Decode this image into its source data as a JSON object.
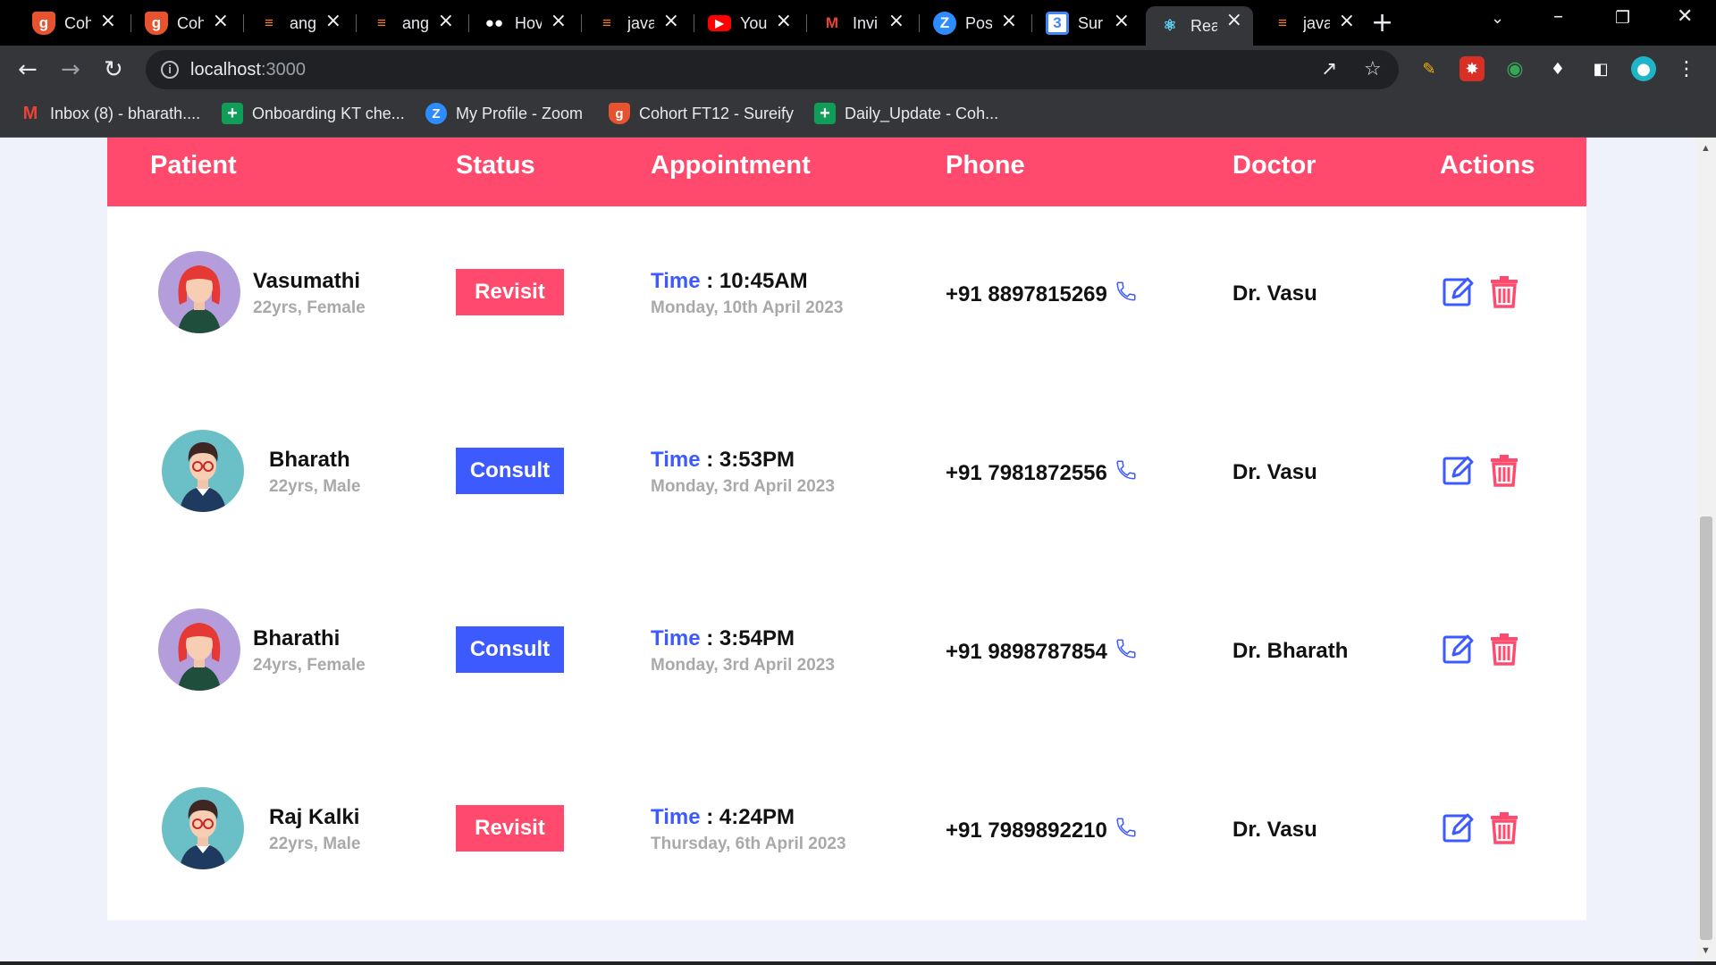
{
  "browser": {
    "tabs": [
      {
        "label": "Coh",
        "icon": "shield-icon",
        "color": "#e8532f"
      },
      {
        "label": "Coh",
        "icon": "shield-icon",
        "color": "#e8532f"
      },
      {
        "label": "ang",
        "icon": "stackoverflow-icon",
        "color": "#f48024"
      },
      {
        "label": "ang",
        "icon": "stackoverflow-icon",
        "color": "#f48024"
      },
      {
        "label": "Hov",
        "icon": "medium-icon",
        "color": "#ffffff"
      },
      {
        "label": "java",
        "icon": "stackoverflow-icon",
        "color": "#f48024"
      },
      {
        "label": "You",
        "icon": "youtube-icon",
        "color": "#ff0000"
      },
      {
        "label": "Invi",
        "icon": "gmail-icon",
        "color": "#ea4335"
      },
      {
        "label": "Pos",
        "icon": "zoom-icon",
        "color": "#2d8cff"
      },
      {
        "label": "Sur",
        "icon": "calendar-icon",
        "color": "#4285f4"
      },
      {
        "label": "Rea",
        "icon": "react-icon",
        "color": "#61dafb",
        "active": true
      },
      {
        "label": "java",
        "icon": "stackoverflow-icon",
        "color": "#f48024"
      }
    ],
    "url_host": "localhost",
    "url_port": ":3000",
    "bookmarks": [
      {
        "label": "Inbox (8) - bharath....",
        "icon": "gmail-icon"
      },
      {
        "label": "Onboarding KT che...",
        "icon": "sheets-icon"
      },
      {
        "label": "My Profile - Zoom",
        "icon": "zoom-icon"
      },
      {
        "label": "Cohort FT12 - Sureify",
        "icon": "shield-icon"
      },
      {
        "label": "Daily_Update - Coh...",
        "icon": "sheets-icon"
      }
    ]
  },
  "table": {
    "headers": {
      "patient": "Patient",
      "status": "Status",
      "appointment": "Appointment",
      "phone": "Phone",
      "doctor": "Doctor",
      "actions": "Actions"
    },
    "time_label": "Time",
    "rows": [
      {
        "name": "Vasumathi",
        "meta": "22yrs, Female",
        "gender": "female",
        "status": "Revisit",
        "time": "10:45AM",
        "date": "Monday, 10th April 2023",
        "phone": "+91 8897815269",
        "doctor": "Dr. Vasu"
      },
      {
        "name": "Bharath",
        "meta": "22yrs, Male",
        "gender": "male",
        "status": "Consult",
        "time": "3:53PM",
        "date": "Monday, 3rd April 2023",
        "phone": "+91 7981872556",
        "doctor": "Dr. Vasu"
      },
      {
        "name": "Bharathi",
        "meta": "24yrs, Female",
        "gender": "female",
        "status": "Consult",
        "time": "3:54PM",
        "date": "Monday, 3rd April 2023",
        "phone": "+91 9898787854",
        "doctor": "Dr. Bharath"
      },
      {
        "name": "Raj Kalki",
        "meta": "22yrs, Male",
        "gender": "male",
        "status": "Revisit",
        "time": "4:24PM",
        "date": "Thursday, 6th April 2023",
        "phone": "+91 7989892210",
        "doctor": "Dr. Vasu"
      }
    ]
  },
  "colors": {
    "header": "#ff4a6d",
    "revisit": "#ff4a6d",
    "consult": "#3d5afe",
    "time_label": "#3d5afe",
    "edit_icon": "#3d5afe",
    "delete_icon": "#ff4a6d"
  }
}
